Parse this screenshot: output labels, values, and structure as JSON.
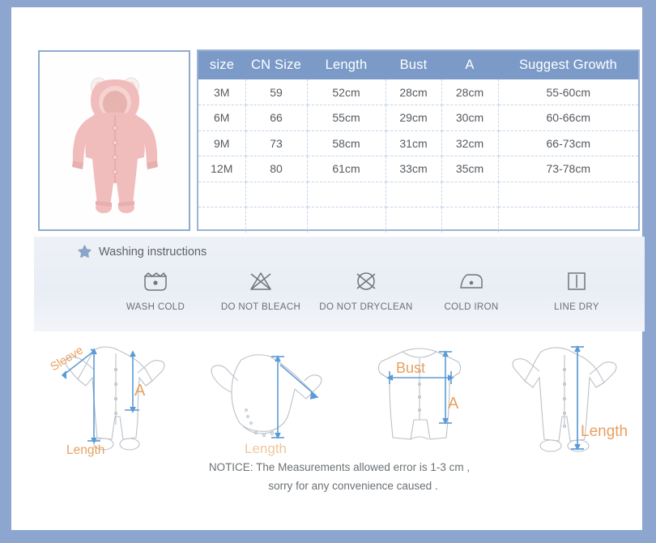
{
  "product": {
    "image_alt": "pink hooded baby romper with bear ears",
    "colors": {
      "garment": "#f0bcbc",
      "garment_shadow": "#e3a7a7",
      "hood_ear": "#f7f2ee"
    }
  },
  "table": {
    "headers": [
      "size",
      "CN Size",
      "Length",
      "Bust",
      "A",
      "Suggest Growth"
    ],
    "rows": [
      [
        "3M",
        "59",
        "52cm",
        "28cm",
        "28cm",
        "55-60cm"
      ],
      [
        "6M",
        "66",
        "55cm",
        "29cm",
        "30cm",
        "60-66cm"
      ],
      [
        "9M",
        "73",
        "58cm",
        "31cm",
        "32cm",
        "66-73cm"
      ],
      [
        "12M",
        "80",
        "61cm",
        "33cm",
        "35cm",
        "73-78cm"
      ],
      [
        "",
        "",
        "",
        "",
        "",
        ""
      ],
      [
        "",
        "",
        "",
        "",
        "",
        ""
      ]
    ],
    "header_bg": "#7b9ac8",
    "border_color": "#9bb3d4",
    "grid_color": "#c4d4e8"
  },
  "care": {
    "title": "Washing instructions",
    "star_icon": "star-icon",
    "star_color": "#8ba5c9",
    "items": [
      {
        "icon": "wash-cold-icon",
        "label": "WASH COLD"
      },
      {
        "icon": "do-not-bleach-icon",
        "label": "DO NOT BLEACH"
      },
      {
        "icon": "do-not-dryclean-icon",
        "label": "DO NOT DRYCLEAN"
      },
      {
        "icon": "cold-iron-icon",
        "label": "COLD IRON"
      },
      {
        "icon": "line-dry-icon",
        "label": "LINE DRY"
      }
    ]
  },
  "diagrams": {
    "arrow_color": "#5b9bd5",
    "label_color": "#e8a060",
    "outline_color": "#b9bec4",
    "items": [
      {
        "name": "footed-romper-front",
        "labels": [
          "Sleeve",
          "A",
          "Length"
        ]
      },
      {
        "name": "short-bodysuit",
        "labels": [
          "Length"
        ]
      },
      {
        "name": "short-sleeve-romper",
        "labels": [
          "Bust",
          "A"
        ]
      },
      {
        "name": "footed-sleeper",
        "labels": [
          "Length"
        ]
      }
    ]
  },
  "notice": {
    "line1": "NOTICE:   The Measurements allowed error is 1-3 cm ,",
    "line2": "sorry for any convenience caused ."
  },
  "frame": {
    "outer_color": "#8ca6d0",
    "sheet_color": "#ffffff"
  }
}
